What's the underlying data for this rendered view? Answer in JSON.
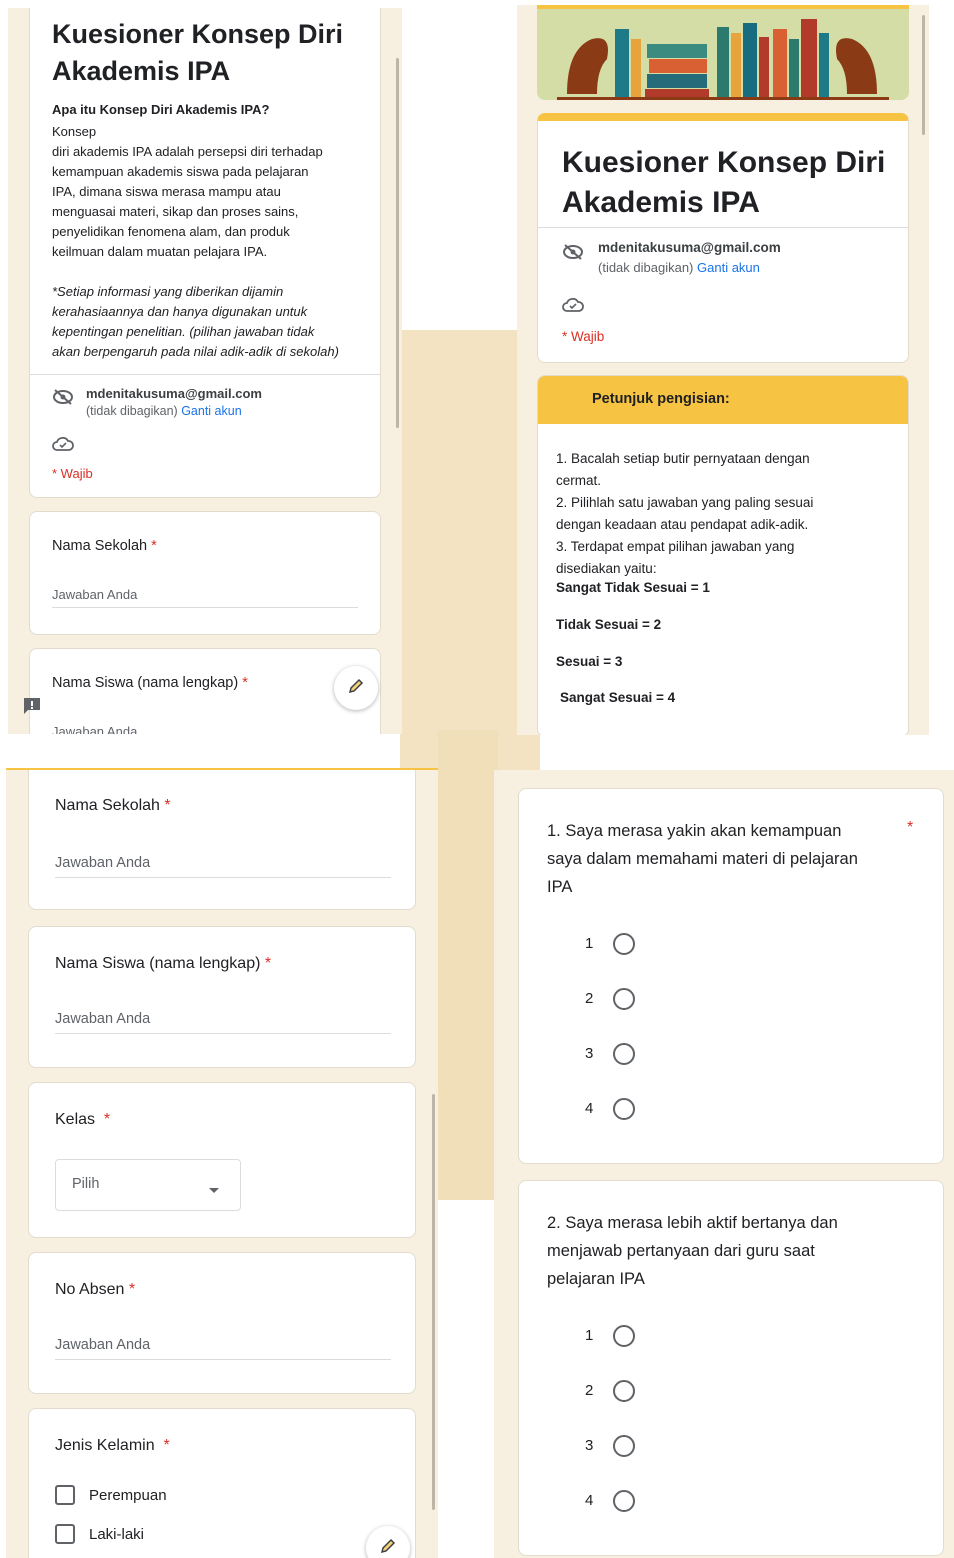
{
  "panel1": {
    "title": "Kuesioner Konsep Diri Akademis IPA",
    "desc_heading": "Apa itu Konsep Diri Akademis IPA?",
    "desc_lines": [
      "Konsep",
      "diri akademis IPA adalah persepsi diri terhadap",
      "kemampuan akademis siswa pada pelajaran",
      "IPA, dimana siswa merasa mampu atau",
      "menguasai materi, sikap dan proses sains,",
      "penyelidikan fenomena alam, dan produk",
      "keilmuan dalam muatan pelajara IPA."
    ],
    "note_lines": [
      "*Setiap informasi yang diberikan dijamin",
      "kerahasiaannya dan hanya digunakan untuk",
      "kepentingan penelitian. (pilihan jawaban tidak",
      "akan berpengaruh pada nilai adik-adik di sekolah)"
    ],
    "email": "mdenitakusuma@gmail.com",
    "not_shared": "(tidak dibagikan)",
    "switch_account": "Ganti akun",
    "required": "* Wajib",
    "q_school": "Nama Sekolah",
    "q_name": "Nama Siswa (nama lengkap)",
    "answer_placeholder": "Jawaban Anda",
    "answer_placeholder_cut": "Jawaban Anda"
  },
  "panel2": {
    "title": "Kuesioner Konsep Diri Akademis IPA",
    "email": "mdenitakusuma@gmail.com",
    "not_shared": "(tidak dibagikan)",
    "switch_account": "Ganti akun",
    "required": "* Wajib",
    "instructions_title": "Petunjuk pengisian:",
    "instructions": [
      "1. Bacalah setiap butir pernyataan dengan",
      "cermat.",
      "2. Pilihlah satu jawaban yang paling sesuai",
      "dengan keadaan atau pendapat adik-adik.",
      "3. Terdapat empat pilihan jawaban yang",
      "disediakan yaitu:"
    ],
    "scale": [
      "Sangat Tidak Sesuai = 1",
      "Tidak Sesuai = 2",
      "Sesuai = 3",
      "Sangat Sesuai = 4"
    ]
  },
  "panel3": {
    "q_school": "Nama Sekolah",
    "q_name": "Nama Siswa (nama lengkap)",
    "q_class": "Kelas",
    "q_absen": "No Absen",
    "q_gender": "Jenis Kelamin",
    "answer_placeholder": "Jawaban Anda",
    "select_placeholder": "Pilih",
    "gender_options": [
      "Perempuan",
      "Laki-laki"
    ]
  },
  "panel4": {
    "q1_lines": [
      "1. Saya merasa yakin akan kemampuan",
      "saya dalam memahami materi di pelajaran",
      "IPA"
    ],
    "q2_lines": [
      "2. Saya merasa lebih aktif bertanya dan",
      "menjawab pertanyaan dari guru saat",
      "pelajaran IPA"
    ],
    "options": [
      "1",
      "2",
      "3",
      "4"
    ],
    "required_mark": "*"
  },
  "theme": {
    "accent": "#f6c342",
    "required": "#d93025",
    "link": "#1a73e8",
    "panel_bg": "#f7f0e1"
  }
}
